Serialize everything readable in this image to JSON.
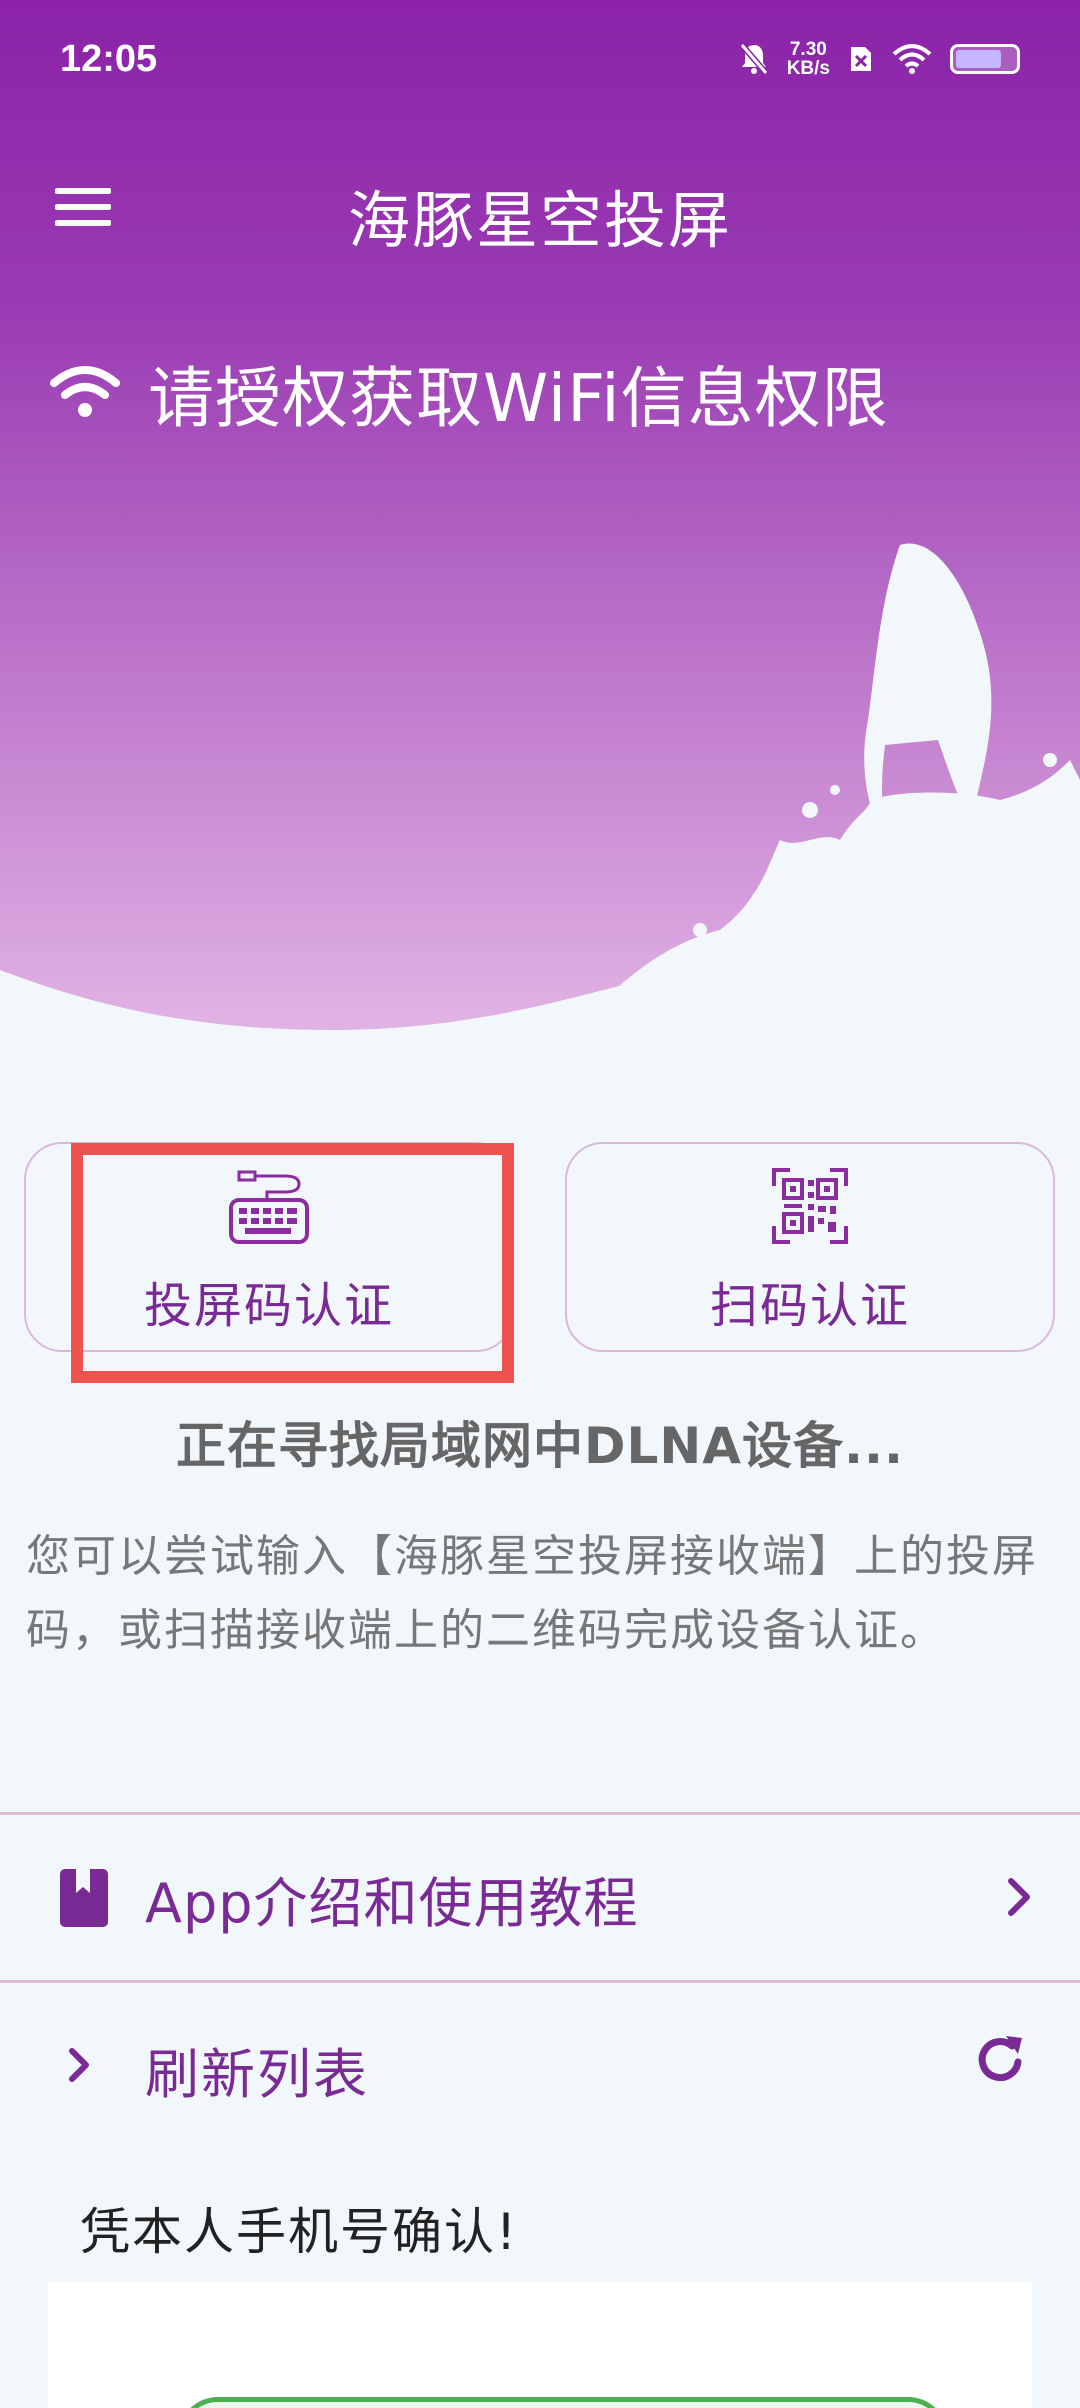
{
  "status_bar": {
    "time": "12:05",
    "net_speed_value": "7.30",
    "net_speed_unit": "KB/s",
    "icons": [
      "mute-icon",
      "sim-icon",
      "wifi-signal-icon",
      "battery-icon"
    ]
  },
  "app_bar": {
    "title": "海豚星空投屏",
    "menu_icon": "hamburger-menu-icon"
  },
  "wifi_prompt": {
    "icon": "wifi-icon",
    "text": "请授权获取WiFi信息权限"
  },
  "auth_options": [
    {
      "label": "投屏码认证",
      "icon": "keyboard-icon"
    },
    {
      "label": "扫码认证",
      "icon": "qr-code-icon"
    }
  ],
  "searching_text": "正在寻找局域网中DLNA设备...",
  "hint_text": "您可以尝试输入【海豚星空投屏接收端】上的投屏码，或扫描接收端上的二维码完成设备认证。",
  "menu_rows": {
    "intro": {
      "label": "App介绍和使用教程",
      "icon": "book-icon",
      "trailing_icon": "chevron-right-icon"
    },
    "refresh": {
      "label": "刷新列表",
      "leading_icon": "chevron-right-icon",
      "trailing_icon": "refresh-icon"
    }
  },
  "phone_confirm_text": "凭本人手机号确认!",
  "colors": {
    "header_top": "#8b22a8",
    "header_bottom": "#dba9e0",
    "accent": "#7a2a95",
    "highlight": "#ef5350",
    "background": "#f2f7fc"
  }
}
